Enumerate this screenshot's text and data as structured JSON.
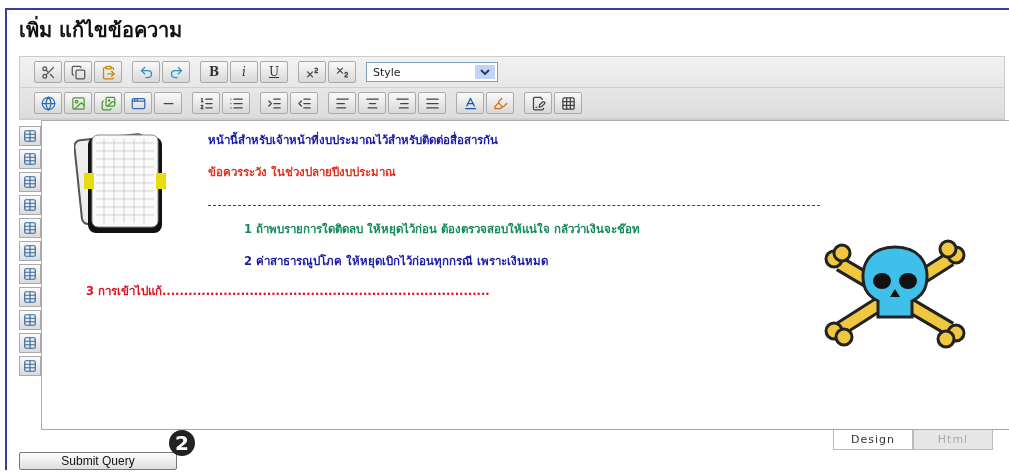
{
  "title": "เพิ่ม แก้ไขข้อความ",
  "toolbar": {
    "rows": [
      [
        [
          {
            "kind": "cut"
          },
          {
            "kind": "copy"
          },
          {
            "kind": "paste"
          }
        ],
        [
          {
            "kind": "undo"
          },
          {
            "kind": "redo"
          }
        ],
        [
          {
            "kind": "letter",
            "label": "B"
          },
          {
            "kind": "letter",
            "label": "i"
          },
          {
            "kind": "letter",
            "label": "U"
          }
        ],
        [
          {
            "kind": "superscript"
          },
          {
            "kind": "subscript"
          }
        ],
        [
          {
            "kind": "select",
            "value": "Style"
          }
        ]
      ],
      [
        [
          {
            "kind": "link"
          },
          {
            "kind": "image"
          },
          {
            "kind": "images"
          },
          {
            "kind": "media"
          },
          {
            "kind": "rule"
          }
        ],
        [
          {
            "kind": "ordered-list"
          },
          {
            "kind": "bullet-list"
          }
        ],
        [
          {
            "kind": "indent"
          },
          {
            "kind": "outdent"
          }
        ],
        [
          {
            "kind": "align-left"
          },
          {
            "kind": "align-center"
          },
          {
            "kind": "align-right"
          },
          {
            "kind": "justify"
          }
        ],
        [
          {
            "kind": "font-color"
          },
          {
            "kind": "highlight"
          }
        ],
        [
          {
            "kind": "edit"
          },
          {
            "kind": "grid"
          }
        ]
      ]
    ]
  },
  "table_tools": [
    {
      "kind": "table"
    },
    {
      "kind": "table"
    },
    {
      "kind": "table"
    },
    {
      "kind": "table"
    },
    {
      "kind": "table"
    },
    {
      "kind": "table"
    },
    {
      "kind": "table"
    },
    {
      "kind": "table"
    },
    {
      "kind": "table"
    },
    {
      "kind": "table"
    },
    {
      "kind": "table"
    }
  ],
  "content": [
    {
      "kind": "text",
      "text": "หน้านี้สำหรับเจ้าหน้าที่งบประมาณไว้สำหรับติดต่อสื่อสารกัน",
      "color": "#1a1aa6"
    },
    {
      "kind": "text",
      "text": "ข้อควรระวัง ในช่วงปลายปีงบประมาณ",
      "color": "#e0301e"
    },
    {
      "kind": "rule"
    },
    {
      "kind": "text",
      "text": "1 ถ้าพบรายการใดติดลบ ให้หยุดไว้ก่อน ต้องตรวจสอบให้แน่ใจ กลัวว่าเงินจะช๊อท",
      "color": "#138a5a"
    },
    {
      "kind": "text",
      "text": "2 ค่าสาธารณูปโภค ให้หยุดเบิกไว้ก่อนทุกกรณี เพราะเงินหมด",
      "color": "#1a1aa6"
    },
    {
      "kind": "text",
      "text": "3 การเข้าไปแก้...........................................................................",
      "color": "#e01020"
    }
  ],
  "badge": "2",
  "tabs": [
    {
      "label": "Design",
      "selected": true
    },
    {
      "label": "Html",
      "selected": false
    }
  ],
  "submit": "Submit Query"
}
